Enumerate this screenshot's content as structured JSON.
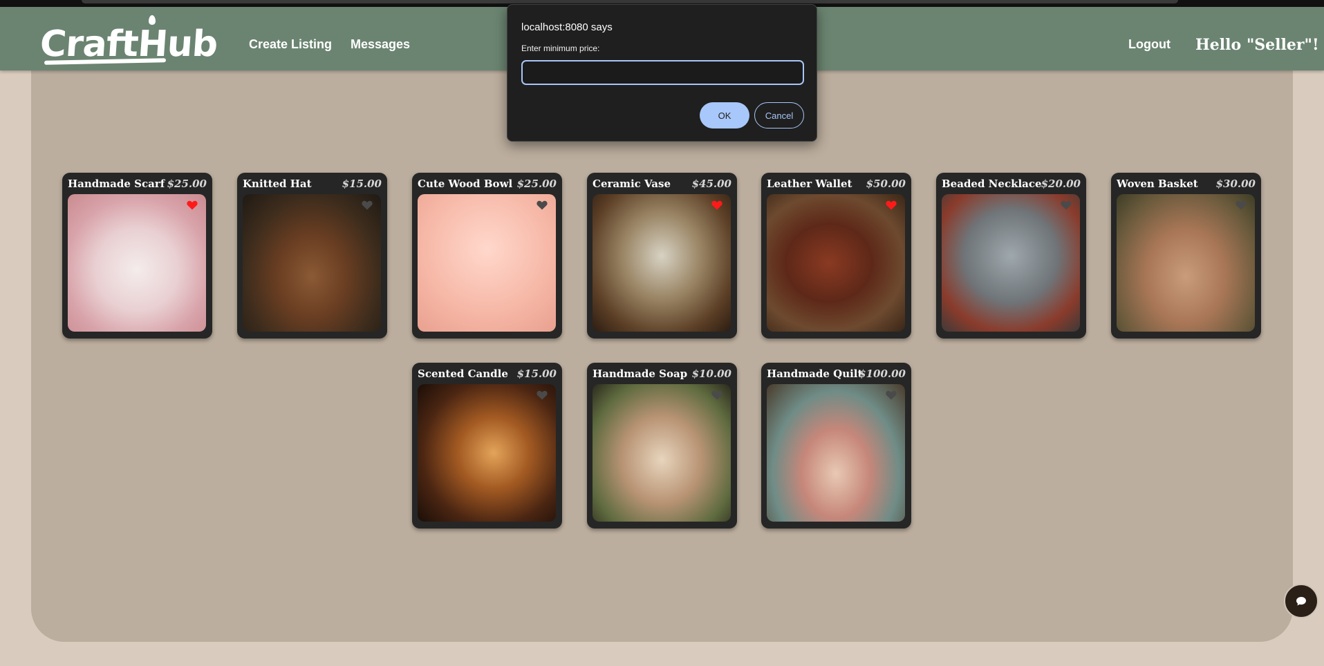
{
  "navbar": {
    "logo_text": "CraftHub",
    "create_listing": "Create Listing",
    "messages": "Messages",
    "logout": "Logout",
    "greeting": "Hello \"Seller\"!"
  },
  "dialog": {
    "title": "localhost:8080 says",
    "message": "Enter minimum price:",
    "input_value": "",
    "ok_label": "OK",
    "cancel_label": "Cancel"
  },
  "products": [
    {
      "title": "Handmade Scarf",
      "price": "$25.00",
      "favorited": true
    },
    {
      "title": "Knitted Hat",
      "price": "$15.00",
      "favorited": false
    },
    {
      "title": "Cute Wood Bowl",
      "price": "$25.00",
      "favorited": false
    },
    {
      "title": "Ceramic Vase",
      "price": "$45.00",
      "favorited": true
    },
    {
      "title": "Leather Wallet",
      "price": "$50.00",
      "favorited": true
    },
    {
      "title": "Beaded Necklace",
      "price": "$20.00",
      "favorited": false
    },
    {
      "title": "Woven Basket",
      "price": "$30.00",
      "favorited": false
    },
    {
      "title": "Scented Candle",
      "price": "$15.00",
      "favorited": false
    },
    {
      "title": "Handmade Soap",
      "price": "$10.00",
      "favorited": false
    },
    {
      "title": "Handmade Quilt",
      "price": "$100.00",
      "favorited": false
    }
  ],
  "colors": {
    "navbar": "#6b8471",
    "panel": "#bcae9e",
    "page": "#d9ccbe",
    "card": "#262626",
    "heart_active": "#ff1a1a",
    "heart_inactive": "#4a4a4a",
    "dialog_accent": "#a8c7fa"
  },
  "icons": {
    "heart": "heart-icon",
    "chat": "chat-bubble-icon"
  }
}
